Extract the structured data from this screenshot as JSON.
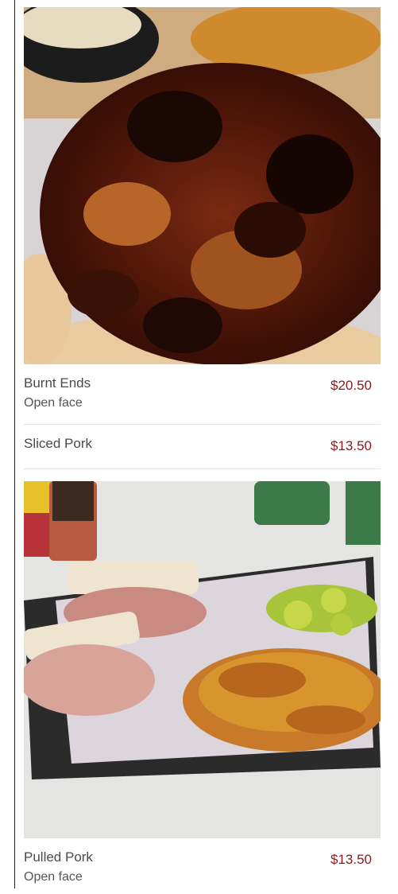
{
  "menu": {
    "items": [
      {
        "name": "Burnt Ends",
        "description": "Open face",
        "price": "$20.50"
      },
      {
        "name": "Sliced Pork",
        "price": "$13.50"
      },
      {
        "name": "Pulled Pork",
        "description": "Open face",
        "price": "$13.50"
      }
    ]
  },
  "colors": {
    "price": "#8b1a1a",
    "divider": "#e6e6e6"
  },
  "images": {
    "burnt_ends_photo": "burnt-ends-sandwich-photo",
    "pulled_pork_photo": "pulled-pork-sandwich-fries-photo"
  }
}
